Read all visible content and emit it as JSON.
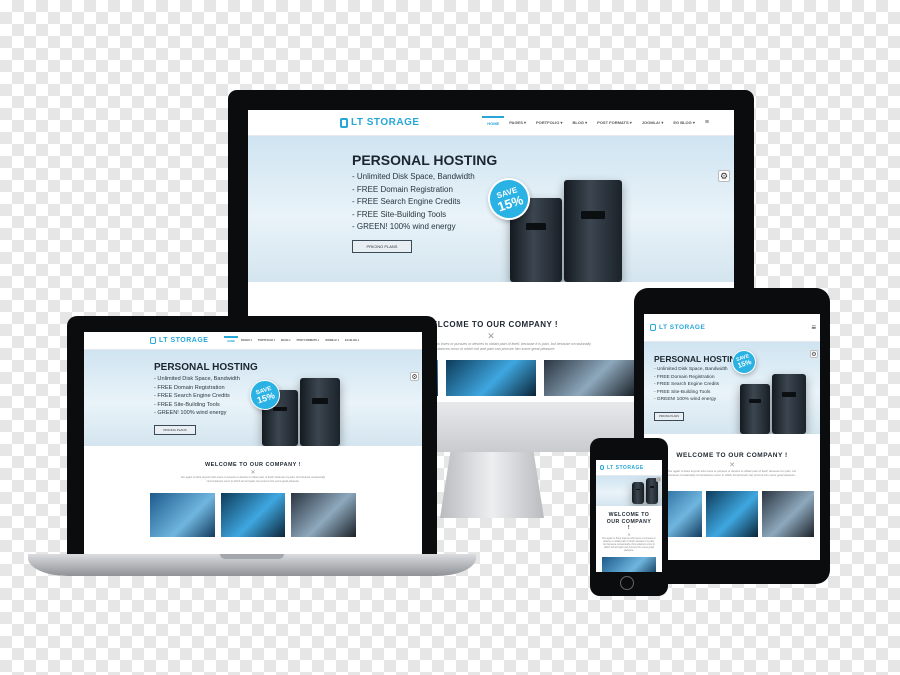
{
  "brand": {
    "logo_text": "LT STORAGE",
    "accent": "#27a6d8"
  },
  "nav": {
    "items": [
      "HOME",
      "PAGES ▾",
      "PORTFOLIO ▾",
      "BLOG ▾",
      "POST FORMATS ▾",
      "JOOMLA! ▾",
      "EG BLOG ▾"
    ]
  },
  "hero": {
    "title": "PERSONAL HOSTING",
    "features": [
      "- Unlimited Disk Space, Bandwidth",
      "- FREE Domain Registration",
      "- FREE Search Engine Credits",
      "- FREE Site-Building Tools",
      "- GREEN! 100% wind energy"
    ],
    "cta_label": "PRICING PLANS",
    "badge_line1": "SAVE",
    "badge_line2": "15%"
  },
  "welcome": {
    "title": "WELCOME TO OUR COMPANY !",
    "phone_title": "WELCOME TO OUR COMPANY !",
    "intro": "Nor again is there anyone who loves or pursues or desires to obtain pain of itself, because it is pain, but because occasionally circumstances occur in which toil and pain can procure him some great pleasure."
  },
  "icons": {
    "gear": "⚙",
    "apple": "",
    "menu": "≡",
    "cross": "✕"
  }
}
